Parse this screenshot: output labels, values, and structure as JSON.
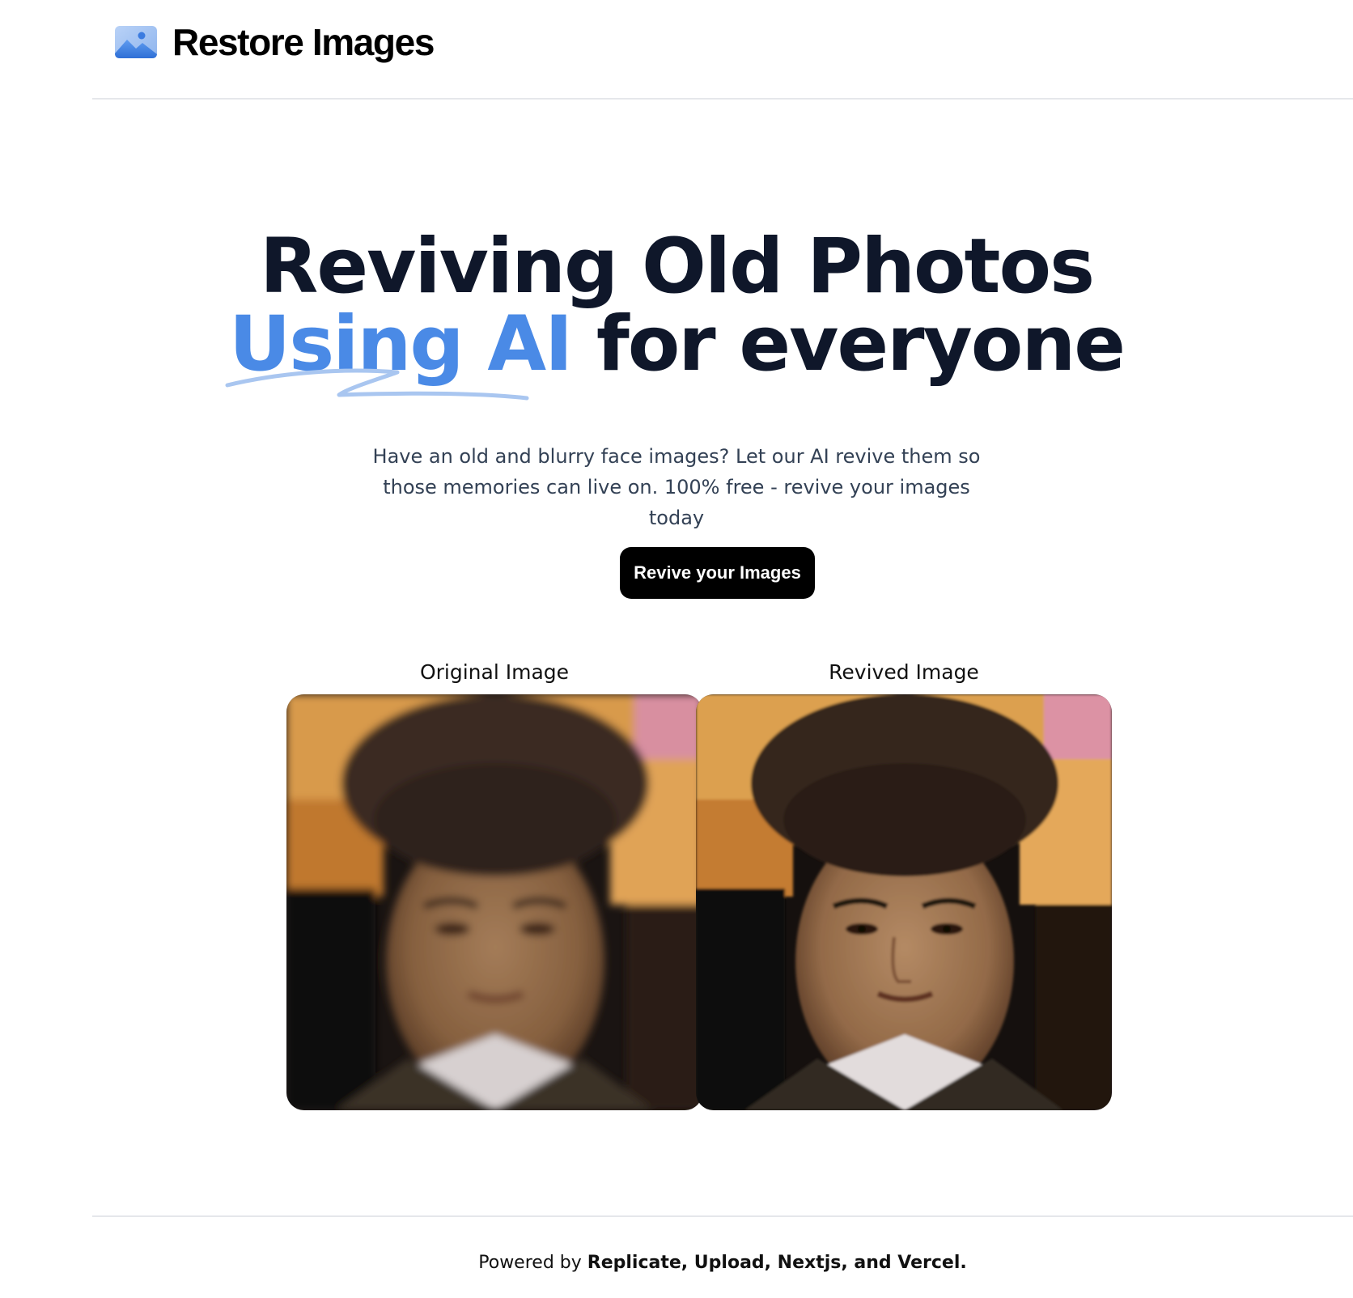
{
  "header": {
    "logo_icon": "image-icon",
    "brand": "Restore Images"
  },
  "hero": {
    "title_line1": "Reviving Old Photos",
    "title_accent": "Using AI",
    "title_rest": " for everyone",
    "subtitle_line1": "Have an old and blurry face images? Let our AI revive them so",
    "subtitle_line2": "those memories can live on. 100% free - revive your images today",
    "cta_label": "Revive your Images"
  },
  "comparison": {
    "original_label": "Original Image",
    "original_alt": "Original blurry photo",
    "revived_label": "Revived Image",
    "revived_alt": "Revived sharp photo"
  },
  "footer": {
    "prefix": "Powered by ",
    "credits": "Replicate, Upload, Nextjs, and Vercel."
  },
  "colors": {
    "accent": "#4a8ae6",
    "title": "#0f172a",
    "button_bg": "#000000",
    "button_text": "#ffffff",
    "divider": "#e5e7eb"
  }
}
